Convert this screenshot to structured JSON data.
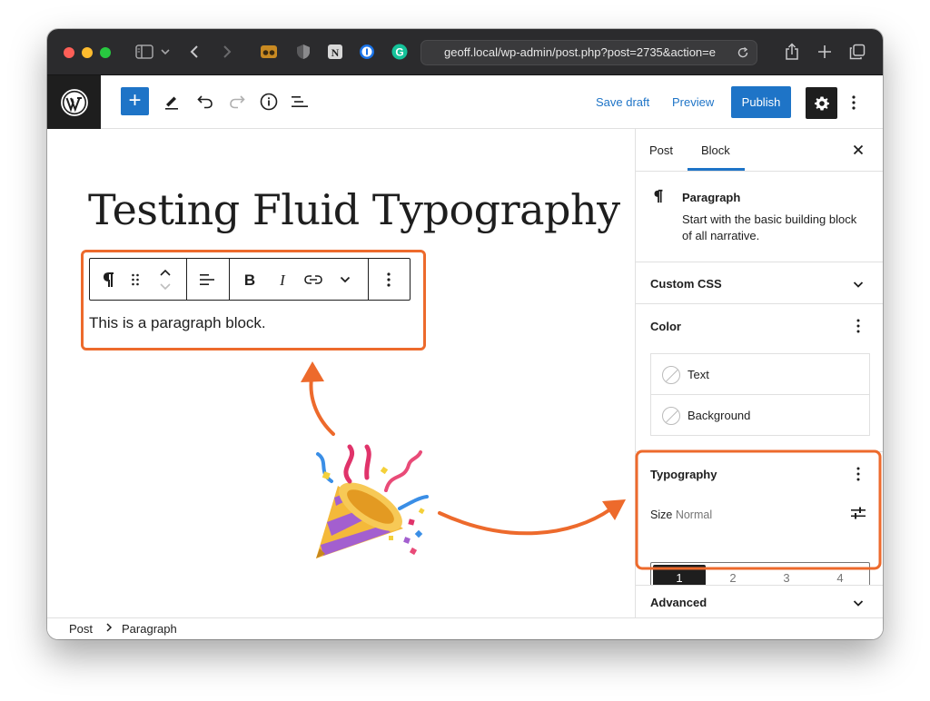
{
  "browser": {
    "url": "geoff.local/wp-admin/post.php?post=2735&action=e",
    "traffic_lights": [
      "#fe5f57",
      "#febc2e",
      "#28c840"
    ]
  },
  "header": {
    "save_draft": "Save draft",
    "preview": "Preview",
    "publish": "Publish",
    "accent": "#1e74c7"
  },
  "editor": {
    "title": "Testing Fluid Typography",
    "paragraph": "This is a paragraph block.",
    "highlight_color": "#ed6a2c"
  },
  "sidebar": {
    "tabs": [
      "Post",
      "Block"
    ],
    "active_tab": "Block",
    "block": {
      "name": "Paragraph",
      "description_line1": "Start with the basic building block",
      "description_line2": "of all narrative."
    },
    "custom_css": "Custom CSS",
    "color": {
      "title": "Color",
      "items": [
        "Text",
        "Background"
      ]
    },
    "typography": {
      "title": "Typography",
      "size_label": "Size",
      "size_value": "Normal",
      "options": [
        "1",
        "2",
        "3",
        "4"
      ],
      "selected_index": 0
    },
    "advanced": "Advanced"
  },
  "breadcrumb": [
    "Post",
    "Paragraph"
  ]
}
